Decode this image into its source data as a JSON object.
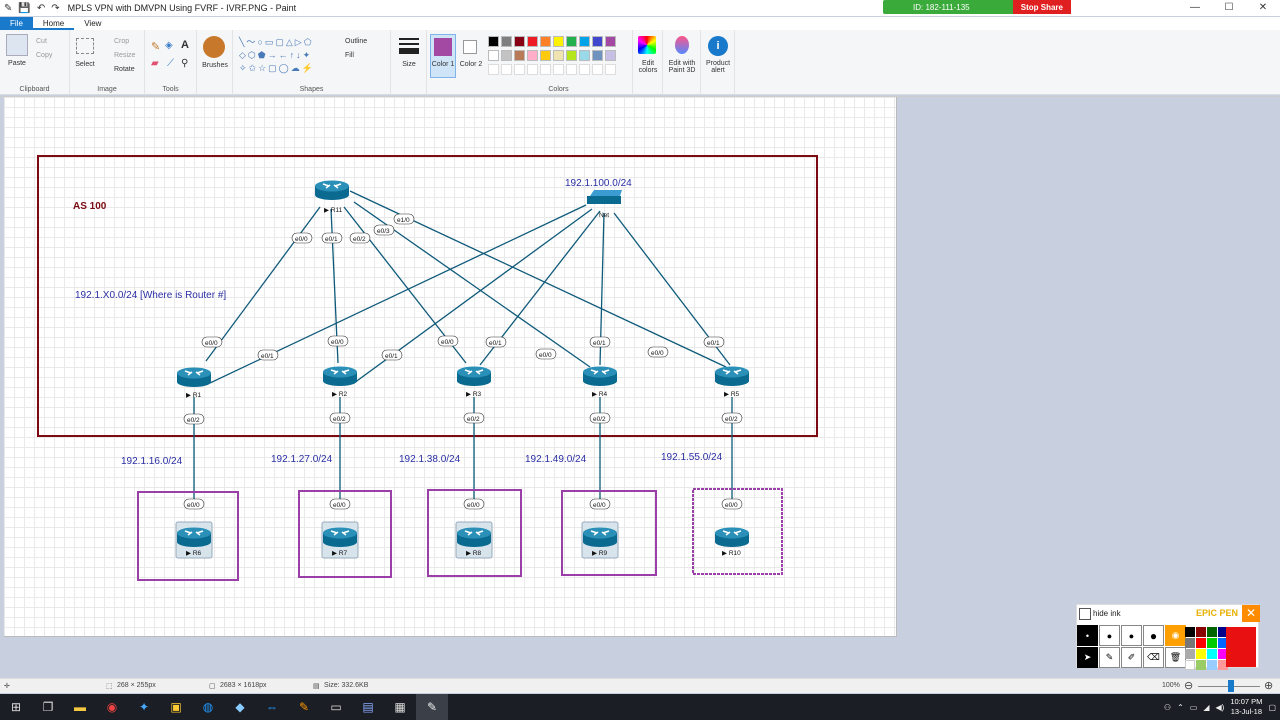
{
  "window": {
    "title": "MPLS VPN with DMVPN Using FVRF - IVRF.PNG - Paint",
    "qa_icons": [
      "save-icon",
      "undo-icon",
      "redo-icon"
    ],
    "controls": [
      "—",
      "☐",
      "✕"
    ]
  },
  "share": {
    "id_text": "ID: 182-111-135",
    "stop_label": "Stop Share",
    "color": "#3aaa3a",
    "stop_color": "#e02020"
  },
  "menu": {
    "file": "File",
    "home": "Home",
    "view": "View"
  },
  "ribbon": {
    "clipboard": {
      "label": "Clipboard",
      "paste": "Paste",
      "cut": "Cut",
      "copy": "Copy"
    },
    "image": {
      "label": "Image",
      "select": "Select",
      "crop": "Crop",
      "resize": "Resize",
      "rotate": "Rotate"
    },
    "tools": {
      "label": "Tools"
    },
    "brushes": "Brushes",
    "shapes": {
      "label": "Shapes",
      "outline": "Outline",
      "fill": "Fill"
    },
    "size": "Size",
    "color1": "Color 1",
    "color2": "Color 2",
    "colors": {
      "label": "Colors",
      "palette_row1": [
        "#000000",
        "#7f7f7f",
        "#880015",
        "#ed1c24",
        "#ff7f27",
        "#fff200",
        "#22b14c",
        "#00a2e8",
        "#3f48cc",
        "#a349a4"
      ],
      "palette_row2": [
        "#ffffff",
        "#c3c3c3",
        "#b97a57",
        "#ffaec9",
        "#ffc90e",
        "#efe4b0",
        "#b5e61d",
        "#99d9ea",
        "#7092be",
        "#c8bfe7"
      ],
      "color1_value": "#a349a4"
    },
    "edit_colors": "Edit colors",
    "edit_paint3d": "Edit with Paint 3D",
    "product_alert": "Product alert"
  },
  "diagram": {
    "as_label": "AS 100",
    "net_subnet": "192.1.100.0/24",
    "router_note": "192.1.X0.0/24 [Where is Router #]",
    "net_label": "Net",
    "routers": {
      "r11": "R11",
      "r1": "R1",
      "r2": "R2",
      "r3": "R3",
      "r4": "R4",
      "r5": "R5",
      "r6": "R6",
      "r7": "R7",
      "r8": "R8",
      "r9": "R9",
      "r10": "R10"
    },
    "r11_ports": [
      "e0/0",
      "e0/1",
      "e0/2",
      "e0/3",
      "e1/0"
    ],
    "upper_ports": {
      "r1": [
        "e0/0",
        "e0/1"
      ],
      "r2": [
        "e0/0",
        "e0/1"
      ],
      "r3": [
        "e0/0",
        "e0/1"
      ],
      "r4": [
        "e0/0",
        "e0/1"
      ],
      "r5": [
        "e0/0",
        "e0/1"
      ]
    },
    "down_ports": [
      "e0/2",
      "e0/2",
      "e0/2",
      "e0/2",
      "e0/2"
    ],
    "site_ports": [
      "e0/0",
      "e0/0",
      "e0/0",
      "e0/0",
      "e0/0"
    ],
    "site_subnets": [
      "192.1.16.0/24",
      "192.1.27.0/24",
      "192.1.38.0/24",
      "192.1.49.0/24",
      "192.1.55.0/24"
    ],
    "as_color": "#7b0a12",
    "site_color": "#9b3fa8",
    "link_color": "#0e5a7a"
  },
  "epicpen": {
    "hide_ink": "hide ink",
    "brand": "EPIC PEN",
    "close": "✕",
    "big_color": "#e81010"
  },
  "statusbar": {
    "selection": "268 × 255px",
    "image_size": "2683 × 1618px",
    "file_size": "Size: 332.6KB",
    "zoom": "100%"
  },
  "taskbar": {
    "time": "10:07 PM",
    "date": "13-Jul-18"
  }
}
